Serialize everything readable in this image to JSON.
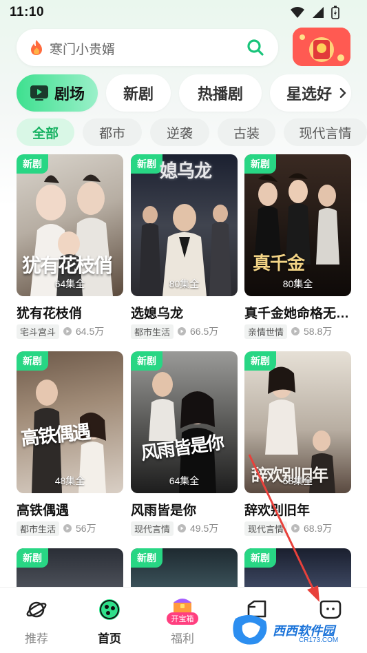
{
  "status_bar": {
    "time": "11:10"
  },
  "search": {
    "placeholder": "寒门小贵婿"
  },
  "tabs": [
    {
      "label": "剧场",
      "active": true
    },
    {
      "label": "新剧",
      "active": false
    },
    {
      "label": "热播剧",
      "active": false
    },
    {
      "label": "星选好",
      "active": false
    }
  ],
  "categories": [
    {
      "label": "全部",
      "active": true
    },
    {
      "label": "都市",
      "active": false
    },
    {
      "label": "逆袭",
      "active": false
    },
    {
      "label": "古装",
      "active": false
    },
    {
      "label": "现代言情",
      "active": false
    }
  ],
  "badge_label": "新剧",
  "dramas": [
    {
      "title": "犹有花枝俏",
      "episodes": "64集全",
      "genre": "宅斗宫斗",
      "views": "64.5万",
      "poster_text": "犹有花枝俏"
    },
    {
      "title": "选媳乌龙",
      "episodes": "80集全",
      "genre": "都市生活",
      "views": "66.5万",
      "poster_text": "媳乌龙"
    },
    {
      "title": "真千金她命格无…",
      "episodes": "80集全",
      "genre": "亲情世情",
      "views": "58.8万",
      "poster_text": "真千金"
    },
    {
      "title": "高铁偶遇",
      "episodes": "48集全",
      "genre": "都市生活",
      "views": "56万",
      "poster_text": "高铁偶遇"
    },
    {
      "title": "风雨皆是你",
      "episodes": "64集全",
      "genre": "现代言情",
      "views": "49.5万",
      "poster_text": "风雨皆是你"
    },
    {
      "title": "辞欢别旧年",
      "episodes": "58集全",
      "genre": "现代言情",
      "views": "68.9万",
      "poster_text": "辞欢别旧年"
    },
    {
      "title": "",
      "episodes": "",
      "genre": "",
      "views": "",
      "poster_text": ""
    },
    {
      "title": "",
      "episodes": "",
      "genre": "",
      "views": "",
      "poster_text": ""
    },
    {
      "title": "",
      "episodes": "",
      "genre": "",
      "views": "",
      "poster_text": ""
    }
  ],
  "bottom_nav": [
    {
      "label": "推荐",
      "icon": "planet-icon",
      "active": false
    },
    {
      "label": "首页",
      "icon": "home-dots-icon",
      "active": true
    },
    {
      "label": "福利",
      "icon": "treasure-chest-icon",
      "active": false,
      "sub_badge": "开宝箱"
    },
    {
      "label": "",
      "icon": "folder-icon",
      "active": false
    },
    {
      "label": "",
      "icon": "profile-face-icon",
      "active": false
    }
  ],
  "watermark": {
    "text": "西西软件园",
    "sub": "CR173.COM"
  },
  "colors": {
    "accent": "#28d684",
    "tab_active_start": "#3ee08f",
    "annotation_arrow": "#e8413b"
  }
}
